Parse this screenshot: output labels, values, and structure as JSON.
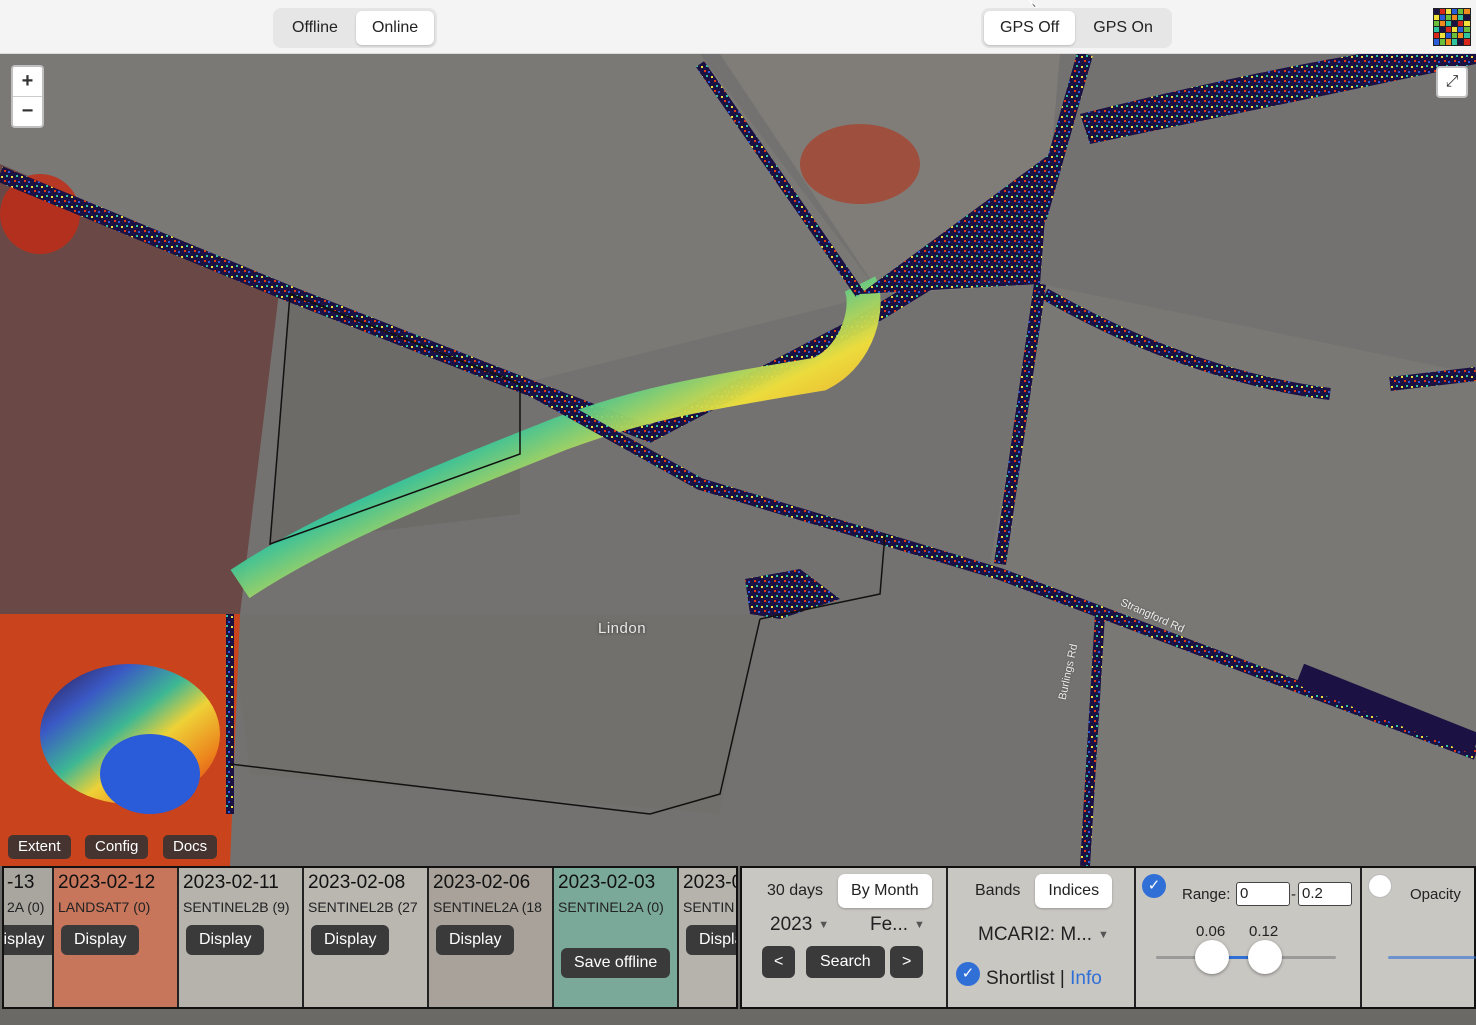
{
  "topbar": {
    "mode_toggle": [
      {
        "label": "Offline",
        "active": false
      },
      {
        "label": "Online",
        "active": true
      }
    ],
    "gps_toggle": [
      {
        "label": "GPS Off",
        "active": true
      },
      {
        "label": "GPS On",
        "active": false
      }
    ],
    "logo_icon": "grid-app-icon"
  },
  "map": {
    "zoom_in": "+",
    "zoom_out": "−",
    "fullscreen_icon": "⤢",
    "place_label": "Lindon",
    "road_labels": [
      "Strangford Rd",
      "Burlings Rd"
    ],
    "buttons": {
      "extent": "Extent",
      "config": "Config",
      "docs": "Docs"
    }
  },
  "results": [
    {
      "date": "-13",
      "sensor": "2A (0)",
      "button": "Display"
    },
    {
      "date": "2023-02-12",
      "sensor": "LANDSAT7 (0)",
      "button": "Display"
    },
    {
      "date": "2023-02-11",
      "sensor": "SENTINEL2B (9)",
      "button": "Display"
    },
    {
      "date": "2023-02-08",
      "sensor": "SENTINEL2B (27",
      "button": "Display"
    },
    {
      "date": "2023-02-06",
      "sensor": "SENTINEL2A (18",
      "button": "Display"
    },
    {
      "date": "2023-02-03",
      "sensor": "SENTINEL2A (0)",
      "button": "Save offline"
    },
    {
      "date": "2023-0",
      "sensor": "SENTIN",
      "button": "Displa"
    }
  ],
  "search_panel": {
    "range_toggle": [
      {
        "label": "30 days",
        "active": false
      },
      {
        "label": "By Month",
        "active": true
      }
    ],
    "year": "2023",
    "month": "Fe...",
    "prev": "<",
    "search": "Search",
    "next": ">"
  },
  "index_panel": {
    "mode_toggle": [
      {
        "label": "Bands",
        "active": false
      },
      {
        "label": "Indices",
        "active": true
      }
    ],
    "index_select": "MCARI2: M...",
    "shortlist": "Shortlist",
    "separator": "|",
    "info": "Info"
  },
  "range_panel": {
    "label": "Range:",
    "min": "0",
    "dash": "-",
    "max": "0.2",
    "low_value": "0.06",
    "high_value": "0.12"
  },
  "opacity_panel": {
    "label": "Opacity",
    "enabled": false
  },
  "colors": {
    "accent": "#2f6fd6",
    "button_dark": "#3a3a3a",
    "water_index_low": "#1b1142",
    "index_high": "#e33a12"
  }
}
